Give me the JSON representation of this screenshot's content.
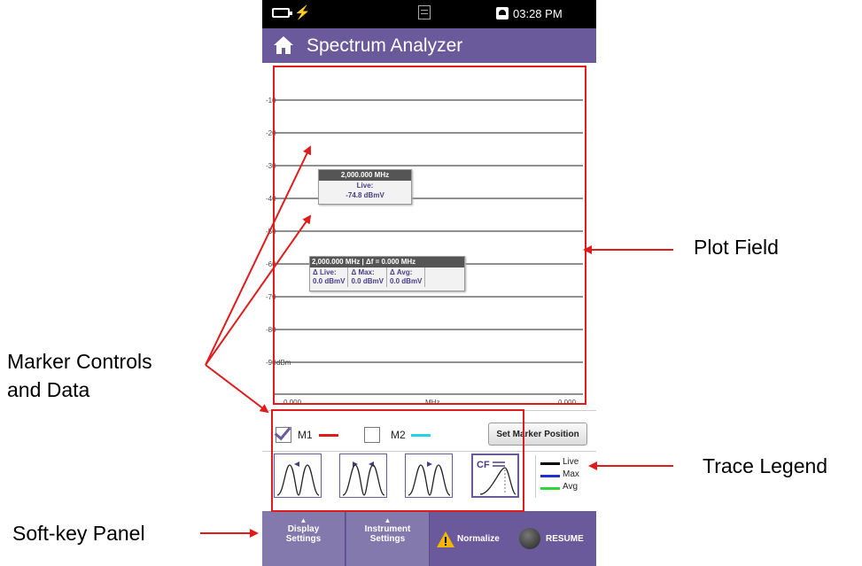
{
  "status_bar": {
    "time": "03:28 PM"
  },
  "header": {
    "title": "Spectrum Analyzer"
  },
  "plot": {
    "y_ticks": [
      "-10",
      "-20",
      "-30",
      "-40",
      "-50",
      "-60",
      "-70",
      "-80",
      "-90"
    ],
    "y_unit": "dBm",
    "x_start": "0.000",
    "x_unit": "MHz",
    "x_end": "0.000"
  },
  "marker1_box": {
    "frequency": "2,000.000 MHz",
    "line1": "Live:",
    "line2": "-74.8 dBmV"
  },
  "marker2_box": {
    "header": "2,000.000 MHz  |  Δf = 0.000 MHz",
    "cells": [
      {
        "label": "Δ Live:",
        "value": "0.0 dBmV"
      },
      {
        "label": "Δ Max:",
        "value": "0.0 dBmV"
      },
      {
        "label": "Δ Avg:",
        "value": "0.0 dBmV"
      }
    ]
  },
  "markers": {
    "m1_label": "M1",
    "m1_color": "#e01b1b",
    "m2_label": "M2",
    "m2_color": "#22d4e8",
    "set_position_button": "Set Marker Position"
  },
  "marker_icons": [
    "peak-left-icon",
    "peak-both-icon",
    "peak-right-icon",
    "center-frequency-icon"
  ],
  "center_freq_icon_text": "CF",
  "trace_legend": [
    {
      "label": "Live",
      "color": "#000000"
    },
    {
      "label": "Max",
      "color": "#1f2fd0"
    },
    {
      "label": "Avg",
      "color": "#2fd63a"
    }
  ],
  "soft_keys": {
    "display_line1": "Display",
    "display_line2": "Settings",
    "instrument_line1": "Instrument",
    "instrument_line2": "Settings",
    "normalize": "Normalize",
    "resume": "RESUME"
  },
  "annotations": {
    "plot_field": "Plot Field",
    "marker_controls_line1": "Marker Controls",
    "marker_controls_line2": "and Data",
    "trace_legend": "Trace Legend",
    "soft_key_panel": "Soft-key Panel"
  },
  "colors": {
    "accent_purple": "#6a5a9b",
    "callout_red": "#e01b1b"
  }
}
